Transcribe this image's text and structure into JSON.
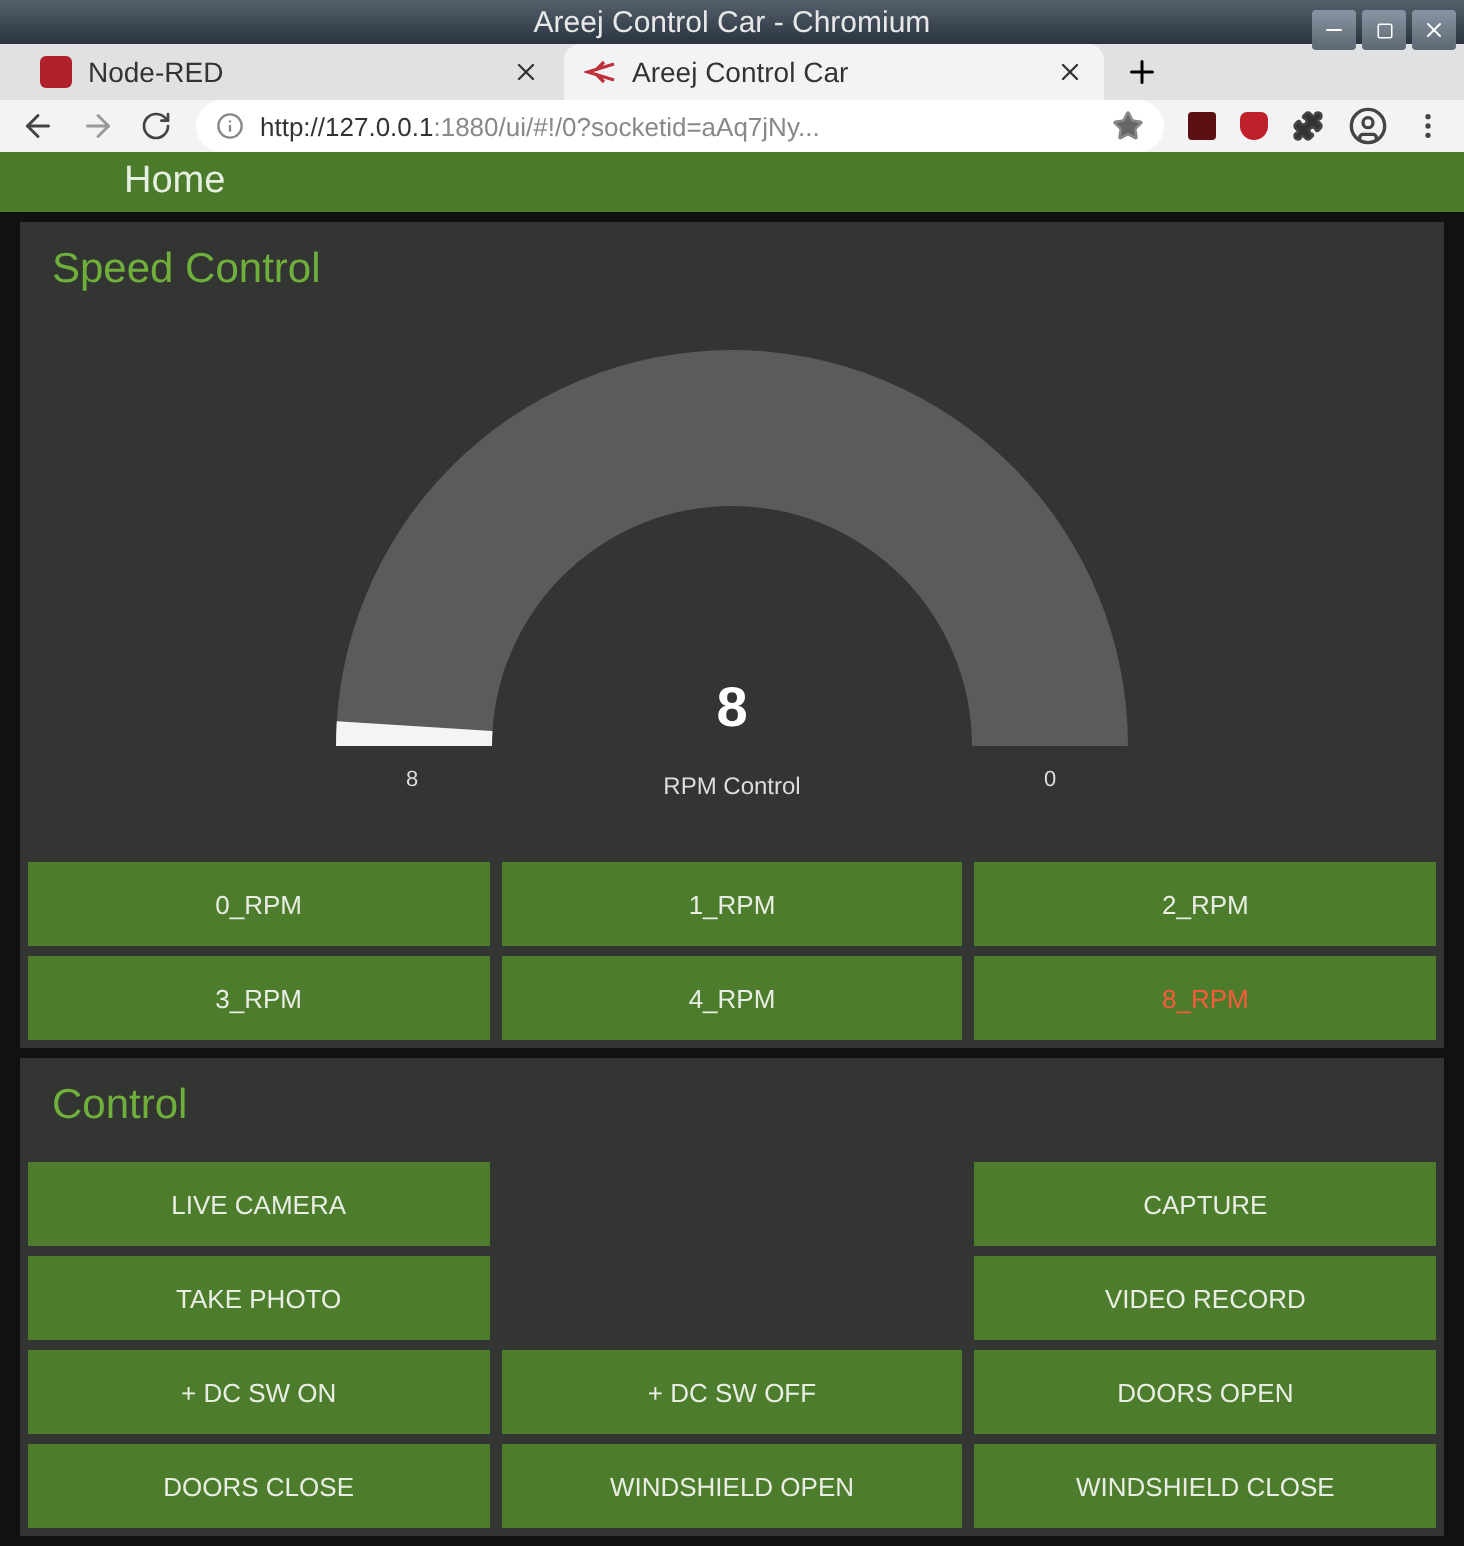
{
  "window": {
    "title": "Areej Control Car - Chromium"
  },
  "tabs": [
    {
      "label": "Node-RED",
      "selected": false
    },
    {
      "label": "Areej Control Car",
      "selected": true
    }
  ],
  "address_bar": {
    "url_host": "http://127.0.0.1",
    "url_rest": ":1880/ui/#!/0?socketid=aAq7jNy..."
  },
  "header": {
    "title": "Home"
  },
  "speed_control": {
    "title": "Speed Control",
    "gauge": {
      "value": "8",
      "label": "RPM Control",
      "min_label": "8",
      "max_label": "0"
    },
    "buttons": [
      {
        "label": "0_RPM",
        "selected": false
      },
      {
        "label": "1_RPM",
        "selected": false
      },
      {
        "label": "2_RPM",
        "selected": false
      },
      {
        "label": "3_RPM",
        "selected": false
      },
      {
        "label": "4_RPM",
        "selected": false
      },
      {
        "label": "8_RPM",
        "selected": true
      }
    ]
  },
  "control": {
    "title": "Control",
    "rows": [
      [
        "LIVE CAMERA",
        null,
        "CAPTURE"
      ],
      [
        "TAKE PHOTO",
        null,
        "VIDEO RECORD"
      ],
      [
        "+ DC SW ON",
        "+ DC SW OFF",
        "DOORS OPEN"
      ],
      [
        "DOORS CLOSE",
        "WINDSHIELD OPEN",
        "WINDSHIELD CLOSE"
      ]
    ]
  }
}
